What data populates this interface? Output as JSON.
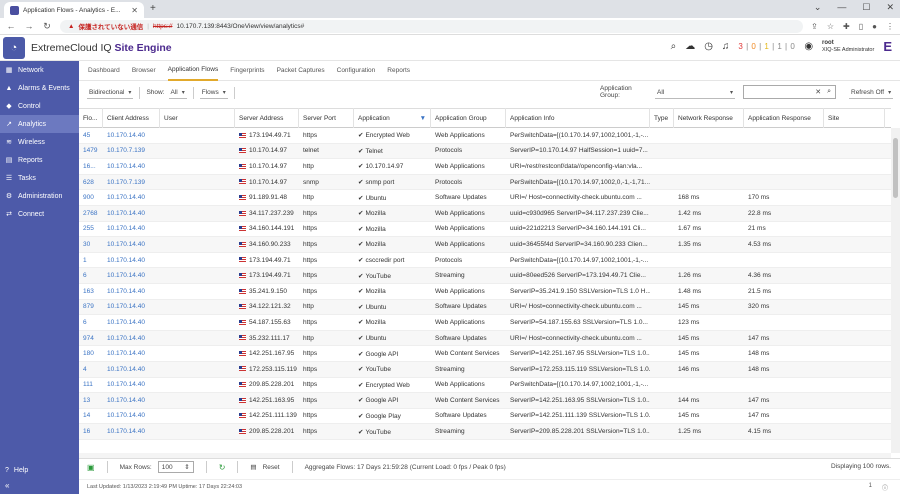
{
  "browser": {
    "tab_title": "Application Flows - Analytics - E...",
    "warning": "保護されていない通信",
    "url_scheme": "https://",
    "url_rest": "10.170.7.139:8443/OneView/view/analytics#"
  },
  "header": {
    "brand_prefix": "ExtremeCloud IQ",
    "brand_suffix": "Site Engine",
    "alarms": {
      "critical": "3",
      "major": "0",
      "minor": "1",
      "warning": "1",
      "info": "0"
    },
    "user_name": "root",
    "user_role": "XIQ-SE Administrator"
  },
  "sidebar": {
    "items": [
      {
        "label": "Network",
        "icon": "network-icon"
      },
      {
        "label": "Alarms & Events",
        "icon": "bell-icon"
      },
      {
        "label": "Control",
        "icon": "shield-icon"
      },
      {
        "label": "Analytics",
        "icon": "chart-icon",
        "active": true
      },
      {
        "label": "Wireless",
        "icon": "wifi-icon"
      },
      {
        "label": "Reports",
        "icon": "report-icon"
      },
      {
        "label": "Tasks",
        "icon": "tasks-icon"
      },
      {
        "label": "Administration",
        "icon": "admin-icon"
      },
      {
        "label": "Connect",
        "icon": "connect-icon"
      }
    ],
    "help": "Help"
  },
  "subtabs": [
    "Dashboard",
    "Browser",
    "Application Flows",
    "Fingerprints",
    "Packet Captures",
    "Configuration",
    "Reports"
  ],
  "filters": {
    "direction": "Bidirectional",
    "show_label": "Show:",
    "show_value": "All",
    "flows": "Flows",
    "app_group_label_1": "Application",
    "app_group_label_2": "Group:",
    "app_group_value": "All",
    "refresh": "Refresh Off"
  },
  "columns": [
    "Flo...",
    "Client Address",
    "User",
    "Server Address",
    "Server Port",
    "Application",
    "Application Group",
    "Application Info",
    "Type",
    "Network Response",
    "Application Response",
    "Site"
  ],
  "rows": [
    [
      "45",
      "10.170.14.40",
      "",
      "173.194.49.71",
      "https",
      "Encrypted Web",
      "Web Applications",
      "PerSwitchData=[(10.170.14.97,1002,1001,-1,-...",
      "",
      "",
      "",
      ""
    ],
    [
      "1479",
      "10.170.7.139",
      "",
      "10.170.14.97",
      "telnet",
      "Telnet",
      "Protocols",
      "ServerIP=10.170.14.97 HalfSession=1 uuid=7...",
      "",
      "",
      "",
      ""
    ],
    [
      "16...",
      "10.170.14.40",
      "",
      "10.170.14.97",
      "http",
      "10.170.14.97",
      "Web Applications",
      "URI=/rest/restconf/data//openconfig-vlan:vla...",
      "",
      "",
      "",
      ""
    ],
    [
      "628",
      "10.170.7.139",
      "",
      "10.170.14.97",
      "snmp",
      "snmp port",
      "Protocols",
      "PerSwitchData=[(10.170.14.97,1002,0,-1,-1,71...",
      "",
      "",
      "",
      ""
    ],
    [
      "900",
      "10.170.14.40",
      "",
      "91.189.91.48",
      "http",
      "Ubuntu",
      "Software Updates",
      "URI=/ Host=connectivity-check.ubuntu.com ...",
      "",
      "168 ms",
      "170 ms",
      ""
    ],
    [
      "2768",
      "10.170.14.40",
      "",
      "34.117.237.239",
      "https",
      "Mozilla",
      "Web Applications",
      "uuid=c930d965 ServerIP=34.117.237.239 Clie...",
      "",
      "1.42 ms",
      "22.8 ms",
      ""
    ],
    [
      "255",
      "10.170.14.40",
      "",
      "34.160.144.191",
      "https",
      "Mozilla",
      "Web Applications",
      "uuid=221d2213 ServerIP=34.160.144.191 Cli...",
      "",
      "1.67 ms",
      "21 ms",
      ""
    ],
    [
      "30",
      "10.170.14.40",
      "",
      "34.160.90.233",
      "https",
      "Mozilla",
      "Web Applications",
      "uuid=36455f4d ServerIP=34.160.90.233 Clien...",
      "",
      "1.35 ms",
      "4.53 ms",
      ""
    ],
    [
      "1",
      "10.170.14.40",
      "",
      "173.194.49.71",
      "https",
      "csccredir port",
      "Protocols",
      "PerSwitchData=[(10.170.14.97,1002,1001,-1,-...",
      "",
      "",
      "",
      ""
    ],
    [
      "6",
      "10.170.14.40",
      "",
      "173.194.49.71",
      "https",
      "YouTube",
      "Streaming",
      "uuid=80eed526 ServerIP=173.194.49.71 Clie...",
      "",
      "1.26 ms",
      "4.36 ms",
      ""
    ],
    [
      "163",
      "10.170.14.40",
      "",
      "35.241.9.150",
      "https",
      "Mozilla",
      "Web Applications",
      "ServerIP=35.241.9.150 SSLVersion=TLS 1.0 H...",
      "",
      "1.48 ms",
      "21.5 ms",
      ""
    ],
    [
      "879",
      "10.170.14.40",
      "",
      "34.122.121.32",
      "http",
      "Ubuntu",
      "Software Updates",
      "URI=/ Host=connectivity-check.ubuntu.com ...",
      "",
      "145 ms",
      "320 ms",
      ""
    ],
    [
      "6",
      "10.170.14.40",
      "",
      "54.187.155.63",
      "https",
      "Mozilla",
      "Web Applications",
      "ServerIP=54.187.155.63 SSLVersion=TLS 1.0...",
      "",
      "123 ms",
      "",
      ""
    ],
    [
      "974",
      "10.170.14.40",
      "",
      "35.232.111.17",
      "http",
      "Ubuntu",
      "Software Updates",
      "URI=/ Host=connectivity-check.ubuntu.com ...",
      "",
      "145 ms",
      "147 ms",
      ""
    ],
    [
      "180",
      "10.170.14.40",
      "",
      "142.251.167.95",
      "https",
      "Google API",
      "Web Content Services",
      "ServerIP=142.251.167.95 SSLVersion=TLS 1.0...",
      "",
      "145 ms",
      "148 ms",
      ""
    ],
    [
      "4",
      "10.170.14.40",
      "",
      "172.253.115.119",
      "https",
      "YouTube",
      "Streaming",
      "ServerIP=172.253.115.119 SSLVersion=TLS 1.0...",
      "",
      "146 ms",
      "148 ms",
      ""
    ],
    [
      "111",
      "10.170.14.40",
      "",
      "209.85.228.201",
      "https",
      "Encrypted Web",
      "Web Applications",
      "PerSwitchData=[(10.170.14.97,1002,1001,-1,-...",
      "",
      "",
      "",
      ""
    ],
    [
      "13",
      "10.170.14.40",
      "",
      "142.251.163.95",
      "https",
      "Google API",
      "Web Content Services",
      "ServerIP=142.251.163.95 SSLVersion=TLS 1.0...",
      "",
      "144 ms",
      "147 ms",
      ""
    ],
    [
      "14",
      "10.170.14.40",
      "",
      "142.251.111.139",
      "https",
      "Google Play",
      "Software Updates",
      "ServerIP=142.251.111.139 SSLVersion=TLS 1.0...",
      "",
      "145 ms",
      "147 ms",
      ""
    ],
    [
      "16",
      "10.170.14.40",
      "",
      "209.85.228.201",
      "https",
      "YouTube",
      "Streaming",
      "ServerIP=209.85.228.201 SSLVersion=TLS 1.0...",
      "",
      "1.25 ms",
      "4.15 ms",
      ""
    ]
  ],
  "footer": {
    "max_rows_label": "Max Rows:",
    "max_rows_value": "100",
    "reset": "Reset",
    "aggregate": "Aggregate Flows: 17 Days 21:59:28 (Current Load: 0 fps / Peak 0 fps)",
    "displaying": "Displaying 100 rows."
  },
  "status": {
    "text": "Last Updated: 1/13/2023 2:19:49 PM   Uptime: 17 Days 22:24:03",
    "count": "1"
  }
}
